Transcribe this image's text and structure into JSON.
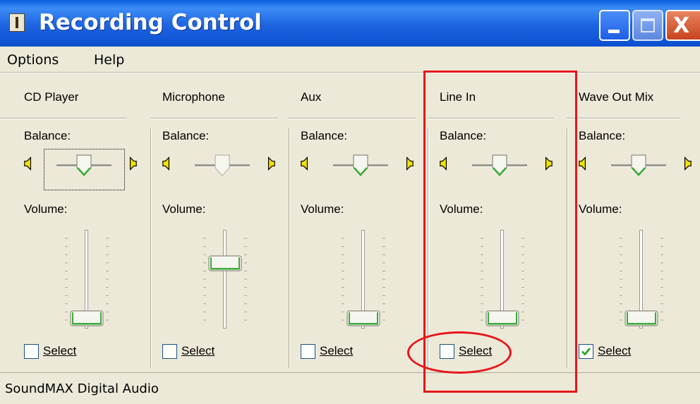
{
  "window": {
    "title": "Recording Control",
    "title_buttons": [
      "minimize",
      "maximize",
      "close"
    ],
    "close_glyph": "X"
  },
  "menu": {
    "options_label": "Options",
    "help_label": "Help"
  },
  "channels": [
    {
      "name": "CD Player",
      "balance_label": "Balance:",
      "volume_label": "Volume:",
      "select_label": "Select",
      "selected": false,
      "enabled": true,
      "balance": 0.5,
      "volume": 0.0
    },
    {
      "name": "Microphone",
      "balance_label": "Balance:",
      "volume_label": "Volume:",
      "select_label": "Select",
      "selected": false,
      "enabled": false,
      "balance": 0.5,
      "volume": 0.75
    },
    {
      "name": "Aux",
      "balance_label": "Balance:",
      "volume_label": "Volume:",
      "select_label": "Select",
      "selected": false,
      "enabled": true,
      "balance": 0.5,
      "volume": 0.0
    },
    {
      "name": "Line In",
      "balance_label": "Balance:",
      "volume_label": "Volume:",
      "select_label": "Select",
      "selected": false,
      "enabled": true,
      "balance": 0.5,
      "volume": 0.0
    },
    {
      "name": "Wave Out Mix",
      "balance_label": "Balance:",
      "volume_label": "Volume:",
      "select_label": "Select",
      "selected": true,
      "enabled": true,
      "balance": 0.5,
      "volume": 0.0
    }
  ],
  "status": {
    "device_name": "SoundMAX Digital Audio"
  },
  "colors": {
    "title_bar": "#1D64E0",
    "window_face": "#ECE9D8",
    "slider_accent": "#3DAA3D",
    "annotation": "#E8151B"
  },
  "icons": {
    "app": "recording-control-app-icon",
    "balance_left": "speaker-left-icon",
    "balance_right": "speaker-right-icon",
    "check": "checkmark-icon"
  }
}
